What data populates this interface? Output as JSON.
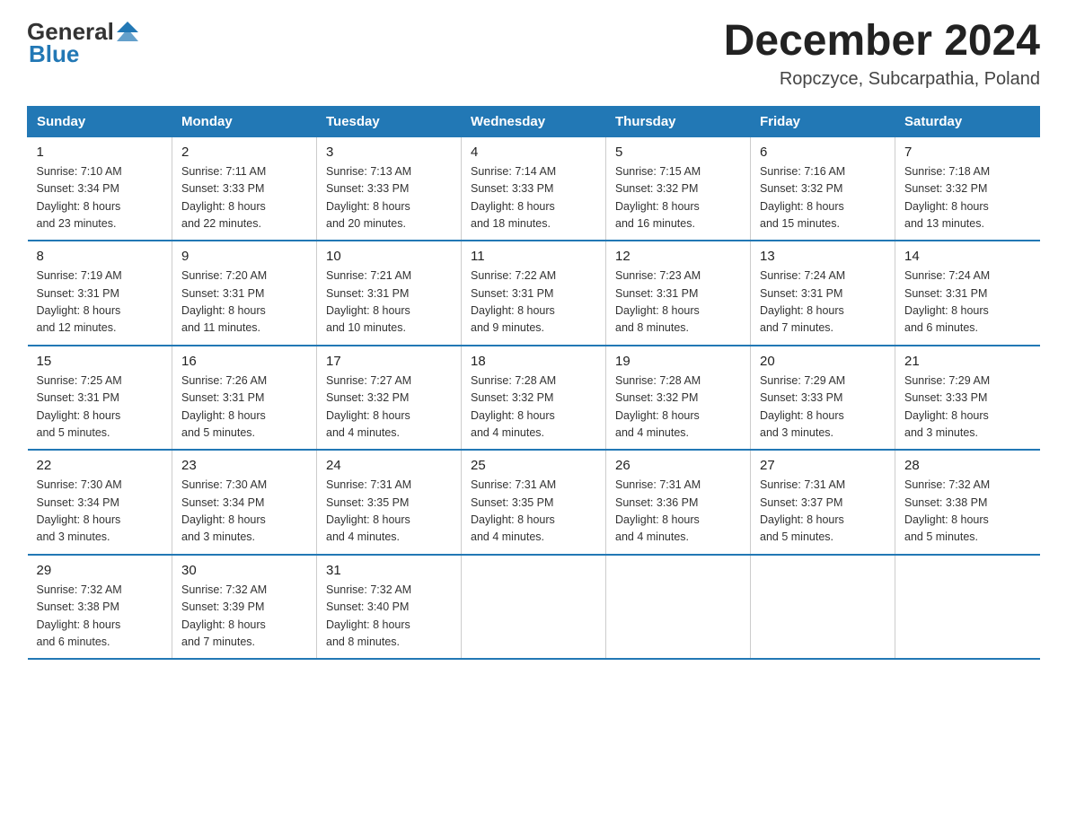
{
  "header": {
    "logo_general": "General",
    "logo_blue": "Blue",
    "month_year": "December 2024",
    "location": "Ropczyce, Subcarpathia, Poland"
  },
  "days_of_week": [
    "Sunday",
    "Monday",
    "Tuesday",
    "Wednesday",
    "Thursday",
    "Friday",
    "Saturday"
  ],
  "weeks": [
    [
      {
        "day": "1",
        "sunrise": "7:10 AM",
        "sunset": "3:34 PM",
        "daylight": "8 hours and 23 minutes."
      },
      {
        "day": "2",
        "sunrise": "7:11 AM",
        "sunset": "3:33 PM",
        "daylight": "8 hours and 22 minutes."
      },
      {
        "day": "3",
        "sunrise": "7:13 AM",
        "sunset": "3:33 PM",
        "daylight": "8 hours and 20 minutes."
      },
      {
        "day": "4",
        "sunrise": "7:14 AM",
        "sunset": "3:33 PM",
        "daylight": "8 hours and 18 minutes."
      },
      {
        "day": "5",
        "sunrise": "7:15 AM",
        "sunset": "3:32 PM",
        "daylight": "8 hours and 16 minutes."
      },
      {
        "day": "6",
        "sunrise": "7:16 AM",
        "sunset": "3:32 PM",
        "daylight": "8 hours and 15 minutes."
      },
      {
        "day": "7",
        "sunrise": "7:18 AM",
        "sunset": "3:32 PM",
        "daylight": "8 hours and 13 minutes."
      }
    ],
    [
      {
        "day": "8",
        "sunrise": "7:19 AM",
        "sunset": "3:31 PM",
        "daylight": "8 hours and 12 minutes."
      },
      {
        "day": "9",
        "sunrise": "7:20 AM",
        "sunset": "3:31 PM",
        "daylight": "8 hours and 11 minutes."
      },
      {
        "day": "10",
        "sunrise": "7:21 AM",
        "sunset": "3:31 PM",
        "daylight": "8 hours and 10 minutes."
      },
      {
        "day": "11",
        "sunrise": "7:22 AM",
        "sunset": "3:31 PM",
        "daylight": "8 hours and 9 minutes."
      },
      {
        "day": "12",
        "sunrise": "7:23 AM",
        "sunset": "3:31 PM",
        "daylight": "8 hours and 8 minutes."
      },
      {
        "day": "13",
        "sunrise": "7:24 AM",
        "sunset": "3:31 PM",
        "daylight": "8 hours and 7 minutes."
      },
      {
        "day": "14",
        "sunrise": "7:24 AM",
        "sunset": "3:31 PM",
        "daylight": "8 hours and 6 minutes."
      }
    ],
    [
      {
        "day": "15",
        "sunrise": "7:25 AM",
        "sunset": "3:31 PM",
        "daylight": "8 hours and 5 minutes."
      },
      {
        "day": "16",
        "sunrise": "7:26 AM",
        "sunset": "3:31 PM",
        "daylight": "8 hours and 5 minutes."
      },
      {
        "day": "17",
        "sunrise": "7:27 AM",
        "sunset": "3:32 PM",
        "daylight": "8 hours and 4 minutes."
      },
      {
        "day": "18",
        "sunrise": "7:28 AM",
        "sunset": "3:32 PM",
        "daylight": "8 hours and 4 minutes."
      },
      {
        "day": "19",
        "sunrise": "7:28 AM",
        "sunset": "3:32 PM",
        "daylight": "8 hours and 4 minutes."
      },
      {
        "day": "20",
        "sunrise": "7:29 AM",
        "sunset": "3:33 PM",
        "daylight": "8 hours and 3 minutes."
      },
      {
        "day": "21",
        "sunrise": "7:29 AM",
        "sunset": "3:33 PM",
        "daylight": "8 hours and 3 minutes."
      }
    ],
    [
      {
        "day": "22",
        "sunrise": "7:30 AM",
        "sunset": "3:34 PM",
        "daylight": "8 hours and 3 minutes."
      },
      {
        "day": "23",
        "sunrise": "7:30 AM",
        "sunset": "3:34 PM",
        "daylight": "8 hours and 3 minutes."
      },
      {
        "day": "24",
        "sunrise": "7:31 AM",
        "sunset": "3:35 PM",
        "daylight": "8 hours and 4 minutes."
      },
      {
        "day": "25",
        "sunrise": "7:31 AM",
        "sunset": "3:35 PM",
        "daylight": "8 hours and 4 minutes."
      },
      {
        "day": "26",
        "sunrise": "7:31 AM",
        "sunset": "3:36 PM",
        "daylight": "8 hours and 4 minutes."
      },
      {
        "day": "27",
        "sunrise": "7:31 AM",
        "sunset": "3:37 PM",
        "daylight": "8 hours and 5 minutes."
      },
      {
        "day": "28",
        "sunrise": "7:32 AM",
        "sunset": "3:38 PM",
        "daylight": "8 hours and 5 minutes."
      }
    ],
    [
      {
        "day": "29",
        "sunrise": "7:32 AM",
        "sunset": "3:38 PM",
        "daylight": "8 hours and 6 minutes."
      },
      {
        "day": "30",
        "sunrise": "7:32 AM",
        "sunset": "3:39 PM",
        "daylight": "8 hours and 7 minutes."
      },
      {
        "day": "31",
        "sunrise": "7:32 AM",
        "sunset": "3:40 PM",
        "daylight": "8 hours and 8 minutes."
      },
      null,
      null,
      null,
      null
    ]
  ],
  "labels": {
    "sunrise_prefix": "Sunrise: ",
    "sunset_prefix": "Sunset: ",
    "daylight_prefix": "Daylight: "
  }
}
